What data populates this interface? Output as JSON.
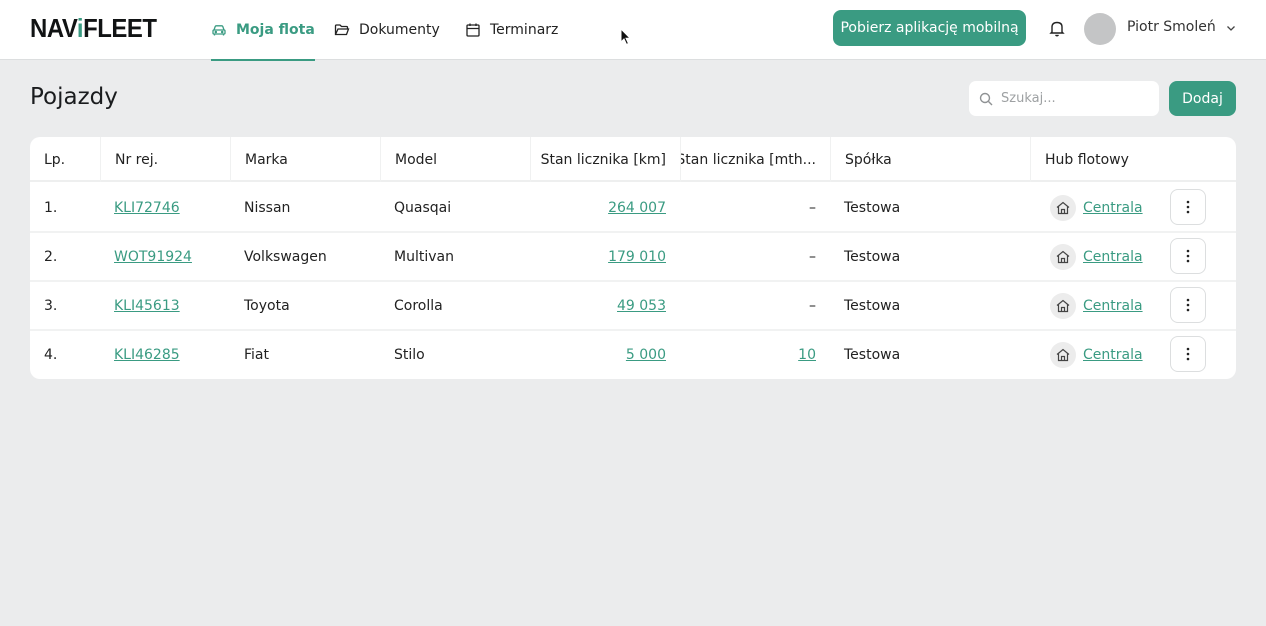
{
  "app": {
    "logo": {
      "before": "NAV",
      "accent": "i",
      "after": "FLEET"
    },
    "nav": [
      {
        "label": "Moja flota",
        "icon": "car-icon",
        "active": true
      },
      {
        "label": "Dokumenty",
        "icon": "folder-icon",
        "active": false
      },
      {
        "label": "Terminarz",
        "icon": "calendar-icon",
        "active": false
      }
    ],
    "mobile_app_button": "Pobierz aplikację mobilną",
    "user": {
      "name": "Piotr Smoleń"
    }
  },
  "page": {
    "title": "Pojazdy",
    "search_placeholder": "Szukaj...",
    "add_button": "Dodaj"
  },
  "table": {
    "columns": [
      "Lp.",
      "Nr rej.",
      "Marka",
      "Model",
      "Stan licznika [km]",
      "Stan licznika [mth...",
      "Spółka",
      "Hub flotowy"
    ],
    "rows": [
      {
        "lp": "1.",
        "nr_rej": "KLI72746",
        "marka": "Nissan",
        "model": "Quasqai",
        "km": "264 007",
        "mth": "–",
        "spolka": "Testowa",
        "hub": "Centrala"
      },
      {
        "lp": "2.",
        "nr_rej": "WOT91924",
        "marka": "Volkswagen",
        "model": "Multivan",
        "km": "179 010",
        "mth": "–",
        "spolka": "Testowa",
        "hub": "Centrala"
      },
      {
        "lp": "3.",
        "nr_rej": "KLI45613",
        "marka": "Toyota",
        "model": "Corolla",
        "km": "49 053",
        "mth": "–",
        "spolka": "Testowa",
        "hub": "Centrala"
      },
      {
        "lp": "4.",
        "nr_rej": "KLI46285",
        "marka": "Fiat",
        "model": "Stilo",
        "km": "5 000",
        "mth": "10",
        "spolka": "Testowa",
        "hub": "Centrala"
      }
    ]
  },
  "colors": {
    "accent": "#3a9b82",
    "background": "#ebeced"
  }
}
